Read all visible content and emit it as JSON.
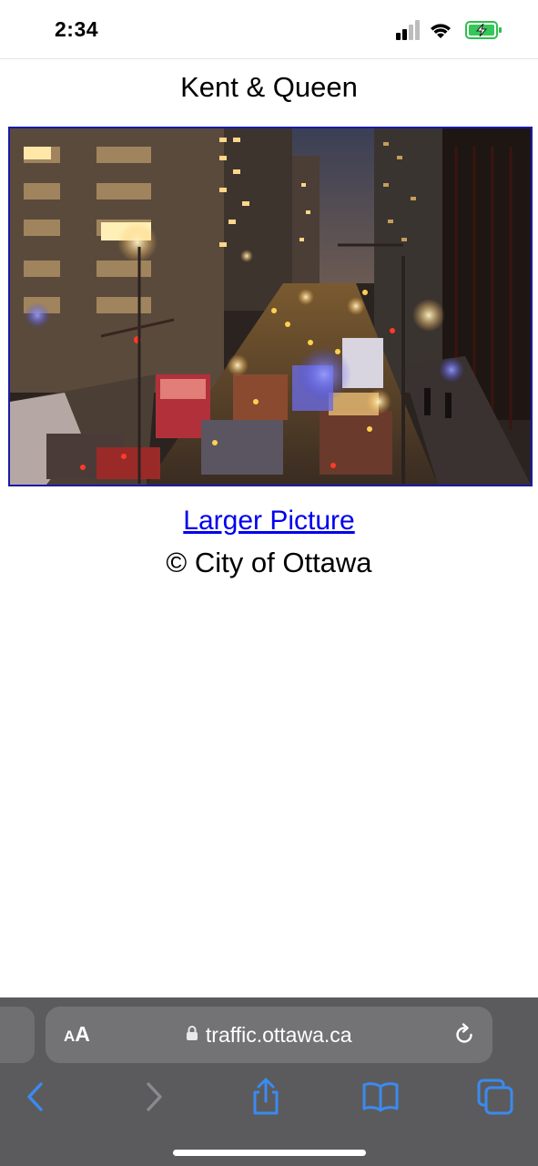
{
  "status_bar": {
    "time": "2:34",
    "icons": [
      "signal-icon",
      "wifi-icon",
      "battery-charging-icon"
    ]
  },
  "page": {
    "title": "Kent & Queen",
    "camera_image": {
      "alt": "Kent & Queen"
    },
    "larger_picture_link": "Larger Picture",
    "copyright": "© City of Ottawa"
  },
  "browser": {
    "text_size_small": "A",
    "text_size_large": "A",
    "url": "traffic.ottawa.ca",
    "toolbar": [
      "back-icon",
      "forward-icon",
      "share-icon",
      "bookmarks-icon",
      "tabs-icon"
    ],
    "accent_color": "#3a8bf0"
  },
  "colors": {
    "link": "#0000ee",
    "image_border": "#1a1aa8",
    "toolbar_bg": "#5b5b5d"
  }
}
